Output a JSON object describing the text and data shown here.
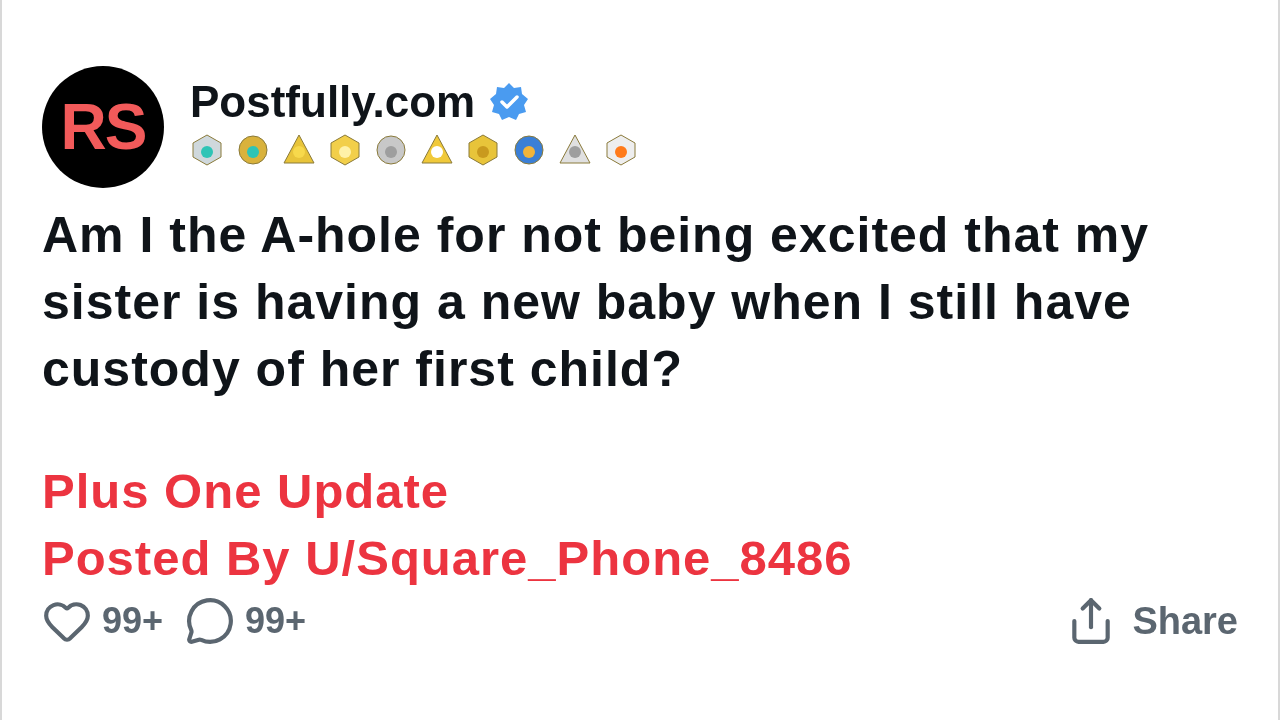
{
  "post": {
    "avatar": {
      "initials": "RS"
    },
    "author": "Postfully.com",
    "verified": true,
    "title": "Am I the A-hole for not being excited that my sister is having a new baby when I still have custody of her first child?",
    "subtitle_lines": [
      "Plus One Update",
      "Posted By U/Square_Phone_8486"
    ],
    "likes": "99+",
    "comments": "99+",
    "share": "Share"
  }
}
